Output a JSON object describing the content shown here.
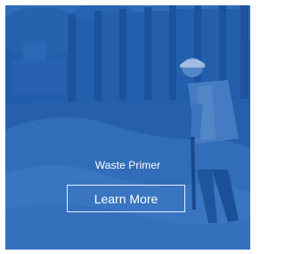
{
  "card": {
    "image_icon": "construction-worker-photo",
    "title": "Waste Primer",
    "cta_label": "Learn More",
    "overlay_color": "#1f5aa8",
    "text_color": "#ffffff"
  }
}
